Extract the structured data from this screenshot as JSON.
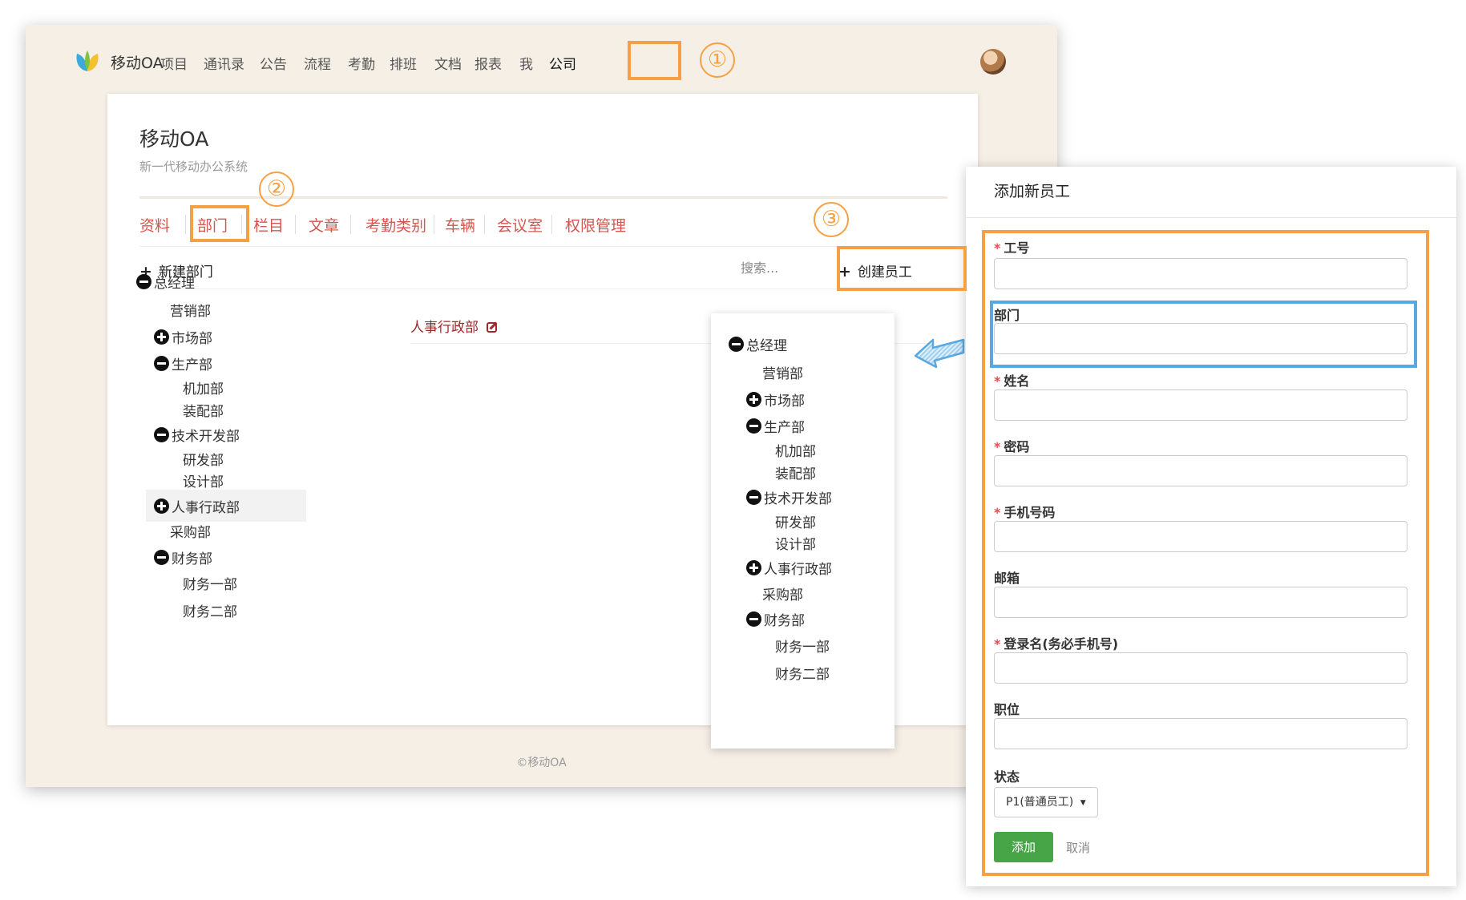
{
  "nav": {
    "brand": "移动OA",
    "items": [
      "项目",
      "通讯录",
      "公告",
      "流程",
      "考勤",
      "排班",
      "文档",
      "报表",
      "我",
      "公司"
    ]
  },
  "card": {
    "title": "移动OA",
    "subtitle": "新一代移动办公系统",
    "tabs": [
      "资料",
      "部门",
      "栏目",
      "文章",
      "考勤类别",
      "车辆",
      "会议室",
      "权限管理"
    ],
    "new_dept": "新建部门",
    "search_placeholder": "搜索...",
    "create_employee": "创建员工",
    "tree": [
      {
        "label": "总经理",
        "toggle": "minus"
      },
      {
        "label": "营销部",
        "toggle": "none"
      },
      {
        "label": "市场部",
        "toggle": "plus"
      },
      {
        "label": "生产部",
        "toggle": "minus"
      },
      {
        "label": "机加部",
        "toggle": "none"
      },
      {
        "label": "装配部",
        "toggle": "none"
      },
      {
        "label": "技术开发部",
        "toggle": "minus"
      },
      {
        "label": "研发部",
        "toggle": "none"
      },
      {
        "label": "设计部",
        "toggle": "none"
      },
      {
        "label": "人事行政部",
        "toggle": "plus",
        "selected": true
      },
      {
        "label": "采购部",
        "toggle": "none"
      },
      {
        "label": "财务部",
        "toggle": "minus"
      },
      {
        "label": "财务一部",
        "toggle": "none"
      },
      {
        "label": "财务二部",
        "toggle": "none"
      }
    ],
    "detail_title": "人事行政部"
  },
  "footer": "©移动OA",
  "annotations": [
    "①",
    "②",
    "③"
  ],
  "form": {
    "title": "添加新员工",
    "fields": [
      {
        "label": "工号",
        "required": true
      },
      {
        "label": "部门",
        "required": false
      },
      {
        "label": "姓名",
        "required": true
      },
      {
        "label": "密码",
        "required": true
      },
      {
        "label": "手机号码",
        "required": true
      },
      {
        "label": "邮箱",
        "required": false
      },
      {
        "label": "登录名(务必手机号)",
        "required": true
      },
      {
        "label": "职位",
        "required": false
      }
    ],
    "status_label": "状态",
    "status_value": "P1(普通员工)",
    "add_button": "添加",
    "cancel": "取消"
  },
  "colors": {
    "highlight_orange": "#f5a044",
    "highlight_blue": "#5aa8e0",
    "tab_red": "#d2574f",
    "add_green": "#47a447",
    "window_bg": "#f5efe6"
  }
}
